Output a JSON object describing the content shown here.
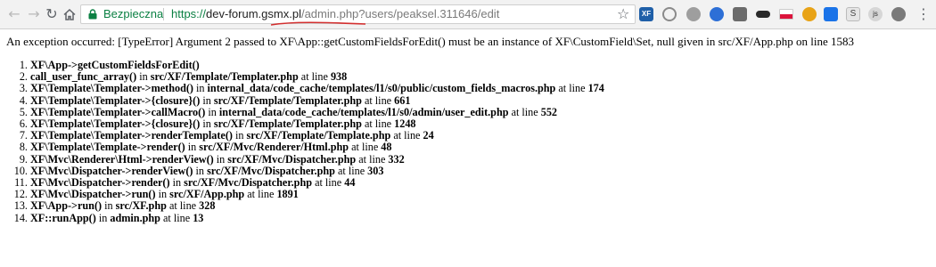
{
  "browser": {
    "security_label": "Bezpieczna",
    "url": {
      "protocol": "https://",
      "host": "dev-forum.gsmx.pl",
      "path": "/admin.php?users/peaksel.311646/edit"
    },
    "icons": [
      "back-icon",
      "forward-icon",
      "reload-icon",
      "home-icon",
      "lock-icon",
      "star-icon"
    ],
    "extensions": [
      {
        "name": "xenforo-extension-icon",
        "color": "#1f5fa8",
        "text": "XF"
      },
      {
        "name": "wordpress-extension-icon",
        "color": "#8a8a8a",
        "text": ""
      },
      {
        "name": "camera-extension-icon",
        "color": "#9e9e9e",
        "text": ""
      },
      {
        "name": "bird-extension-icon",
        "color": "#2d6fd6",
        "text": ""
      },
      {
        "name": "puzzle-extension-icon",
        "color": "#6b6b6b",
        "text": ""
      },
      {
        "name": "glasses-extension-icon",
        "color": "#2a2a2a",
        "text": ""
      },
      {
        "name": "poland-flag-icon",
        "color": "#dc143c",
        "text": ""
      },
      {
        "name": "gear-extension-icon",
        "color": "#e8a317",
        "text": ""
      },
      {
        "name": "window-extension-icon",
        "color": "#1a73e8",
        "text": ""
      },
      {
        "name": "s-extension-icon",
        "color": "#d0d0d0",
        "text": "S"
      },
      {
        "name": "js-extension-icon",
        "color": "#b0b0b0",
        "text": "js"
      },
      {
        "name": "shield-extension-icon",
        "color": "#7a7a7a",
        "text": ""
      },
      {
        "name": "menu-icon",
        "color": "#5f6368",
        "text": "⋮"
      }
    ]
  },
  "page": {
    "error_message": "An exception occurred: [TypeError] Argument 2 passed to XF\\App::getCustomFieldsForEdit() must be an instance of XF\\CustomField\\Set, null given in src/XF/App.php on line 1583",
    "trace": [
      {
        "call": "XF\\App->getCustomFieldsForEdit()",
        "mid": "",
        "file": "",
        "line": ""
      },
      {
        "call": "call_user_func_array()",
        "mid": " in ",
        "file": "src/XF/Template/Templater.php",
        "line": "938"
      },
      {
        "call": "XF\\Template\\Templater->method()",
        "mid": " in ",
        "file": "internal_data/code_cache/templates/l1/s0/public/custom_fields_macros.php",
        "line": "174"
      },
      {
        "call": "XF\\Template\\Templater->{closure}()",
        "mid": " in ",
        "file": "src/XF/Template/Templater.php",
        "line": "661"
      },
      {
        "call": "XF\\Template\\Templater->callMacro()",
        "mid": " in ",
        "file": "internal_data/code_cache/templates/l1/s0/admin/user_edit.php",
        "line": "552"
      },
      {
        "call": "XF\\Template\\Templater->{closure}()",
        "mid": " in ",
        "file": "src/XF/Template/Templater.php",
        "line": "1248"
      },
      {
        "call": "XF\\Template\\Templater->renderTemplate()",
        "mid": " in ",
        "file": "src/XF/Template/Template.php",
        "line": "24"
      },
      {
        "call": "XF\\Template\\Template->render()",
        "mid": " in ",
        "file": "src/XF/Mvc/Renderer/Html.php",
        "line": "48"
      },
      {
        "call": "XF\\Mvc\\Renderer\\Html->renderView()",
        "mid": " in ",
        "file": "src/XF/Mvc/Dispatcher.php",
        "line": "332"
      },
      {
        "call": "XF\\Mvc\\Dispatcher->renderView()",
        "mid": " in ",
        "file": "src/XF/Mvc/Dispatcher.php",
        "line": "303"
      },
      {
        "call": "XF\\Mvc\\Dispatcher->render()",
        "mid": " in ",
        "file": "src/XF/Mvc/Dispatcher.php",
        "line": "44"
      },
      {
        "call": "XF\\Mvc\\Dispatcher->run()",
        "mid": " in ",
        "file": "src/XF/App.php",
        "line": "1891"
      },
      {
        "call": "XF\\App->run()",
        "mid": " in ",
        "file": "src/XF.php",
        "line": "328"
      },
      {
        "call": "XF::runApp()",
        "mid": " in ",
        "file": "admin.php",
        "line": "13"
      }
    ],
    "at_line_label": " at line "
  },
  "colors": {
    "secure_green": "#0b8043",
    "annotation_red": "#d32f2f"
  }
}
